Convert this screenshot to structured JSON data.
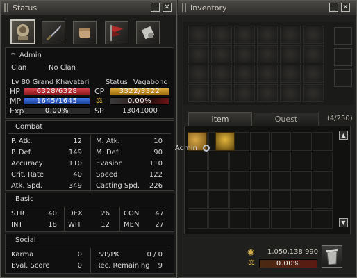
{
  "status_window": {
    "title": "Status",
    "tabs": [
      "portrait-icon",
      "sword-icon",
      "fist-icon",
      "flag-icon",
      "scroll-icon"
    ],
    "character": {
      "name": "Admin",
      "name_prefix": "*",
      "clan_label": "Clan",
      "clan_value": "No Clan",
      "level_line": "Lv  80 Grand Khavatari",
      "status_label": "Status",
      "status_value": "Vagabond",
      "hp_label": "HP",
      "hp_text": "6328/6328",
      "hp_fill": 1.0,
      "mp_label": "MP",
      "mp_text": "1645/1645",
      "mp_fill": 1.0,
      "exp_label": "Exp",
      "exp_text": "0.00%",
      "exp_fill": 0.0,
      "cp_label": "CP",
      "cp_text": "3322/3322",
      "cp_fill": 1.0,
      "weight_text": "0.00%",
      "weight_fill": 0.0,
      "sp_label": "SP",
      "sp_value": "13041000"
    },
    "combat": {
      "header": "Combat",
      "left": [
        {
          "label": "P. Atk.",
          "value": "12"
        },
        {
          "label": "P. Def.",
          "value": "149"
        },
        {
          "label": "Accuracy",
          "value": "110"
        },
        {
          "label": "Crit. Rate",
          "value": "40"
        },
        {
          "label": "Atk. Spd.",
          "value": "349"
        }
      ],
      "right": [
        {
          "label": "M. Atk.",
          "value": "10"
        },
        {
          "label": "M. Def.",
          "value": "90"
        },
        {
          "label": "Evasion",
          "value": "110"
        },
        {
          "label": "Speed",
          "value": "122"
        },
        {
          "label": "Casting Spd.",
          "value": "226"
        }
      ]
    },
    "basic": {
      "header": "Basic",
      "row1": [
        {
          "label": "STR",
          "value": "40"
        },
        {
          "label": "DEX",
          "value": "26"
        },
        {
          "label": "CON",
          "value": "47"
        }
      ],
      "row2": [
        {
          "label": "INT",
          "value": "18"
        },
        {
          "label": "WIT",
          "value": "12"
        },
        {
          "label": "MEN",
          "value": "27"
        }
      ]
    },
    "social": {
      "header": "Social",
      "rows": [
        {
          "l_label": "Karma",
          "l_value": "0",
          "r_label": "PvP/PK",
          "r_value": "0 / 0"
        },
        {
          "l_label": "Eval. Score",
          "l_value": "0",
          "r_label": "Rec. Remaining",
          "r_value": "9"
        }
      ]
    }
  },
  "inventory_window": {
    "title": "Inventory",
    "tabs": [
      {
        "label": "Item"
      },
      {
        "label": "Quest"
      }
    ],
    "count": "(4/250)",
    "tooltip": "Admin",
    "adena": "1,050,138,990",
    "weight_text": "0.00%",
    "weight_fill": 0.0
  },
  "window_buttons": {
    "minimize": "_",
    "close": "✕"
  },
  "colors": {
    "hp": "#b8262c",
    "mp": "#1f56c4",
    "cp": "#c98e1a",
    "exp": "#7a1f23"
  }
}
